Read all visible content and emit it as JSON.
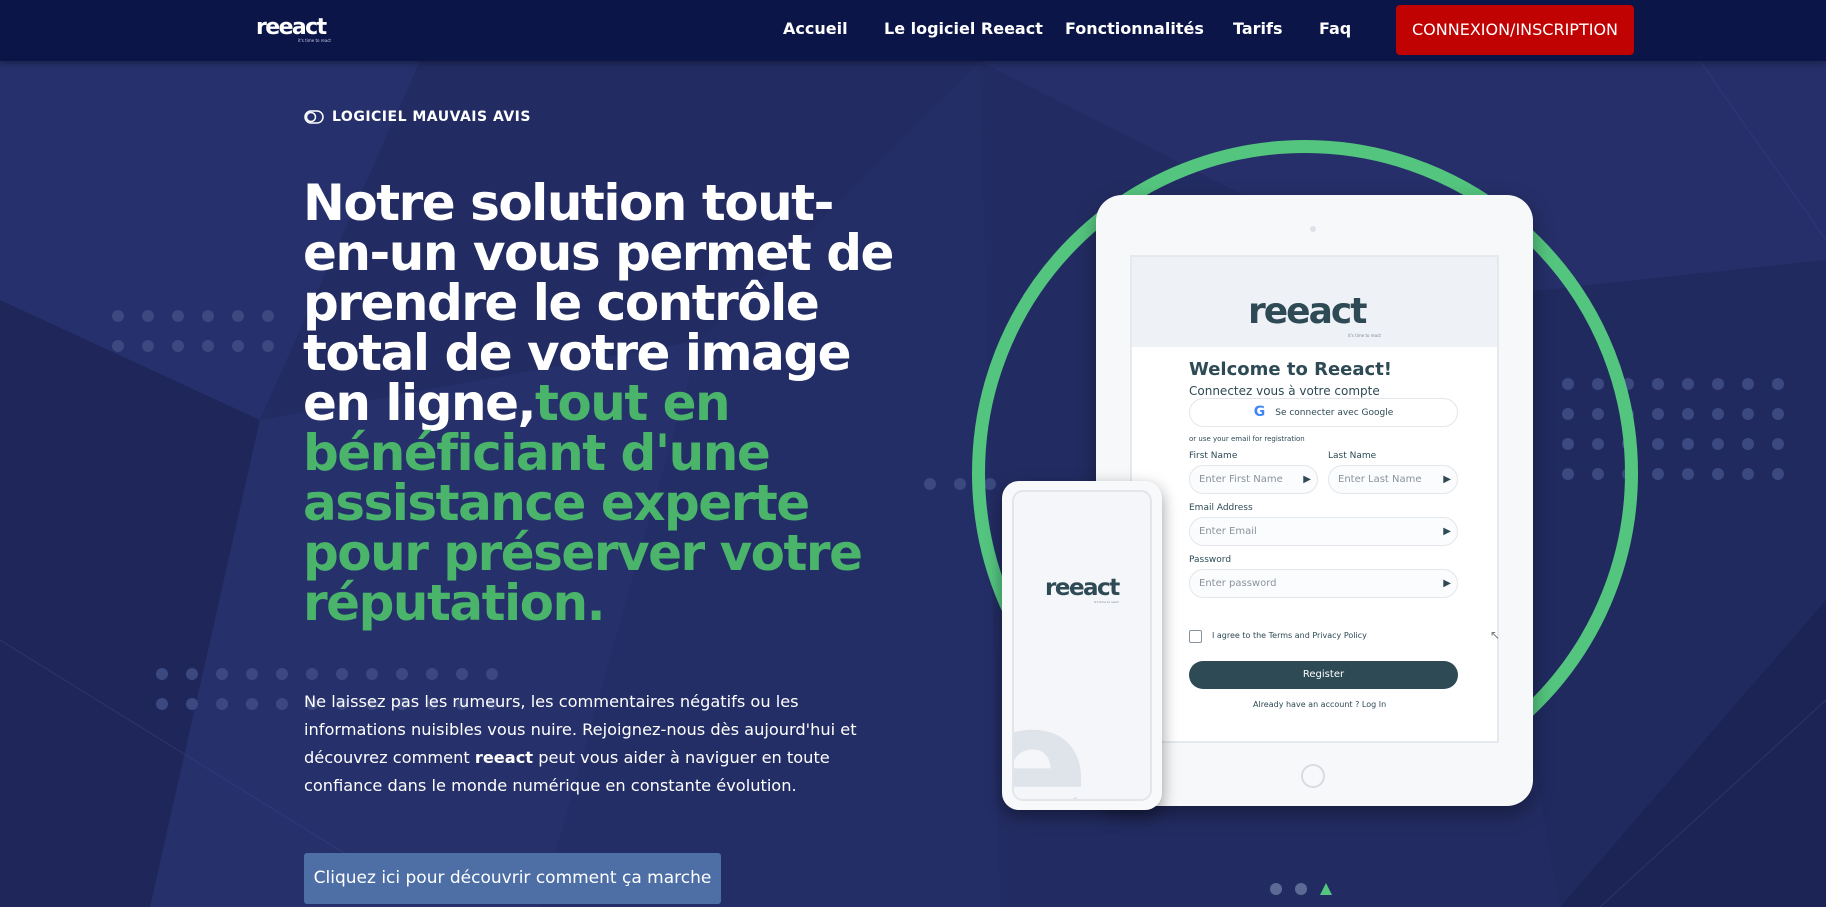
{
  "nav": {
    "logo": "reeact",
    "logo_tagline": "it's time to react",
    "links": [
      "Accueil",
      "Le logiciel Reeact",
      "Fonctionnalités",
      "Tarifs",
      "Faq"
    ],
    "cta_label": "CONNEXION/INSCRIPTION"
  },
  "hero": {
    "eyebrow": "LOGICIEL MAUVAIS AVIS",
    "headline_white": "Notre solution tout-en-un vous permet de prendre le contrôle total de votre image en ligne,",
    "headline_green": "tout en bénéficiant d'une assistance experte pour préserver votre réputation.",
    "paragraph_before": "Ne laissez pas les rumeurs, les commentaires négatifs ou les informations nuisibles vous nuire. Rejoignez-nous dès aujourd'hui et découvrez comment ",
    "paragraph_bold": "reeact",
    "paragraph_after": " peut vous aider à naviguer en toute confiance dans le monde numérique en constante évolution.",
    "button_label": "Cliquez ici pour découvrir comment ça marche"
  },
  "tablet_screen": {
    "logo": "reeact",
    "logo_tagline": "it's time to react",
    "welcome": "Welcome to Reeact!",
    "subtitle": "Connectez vous à votre compte",
    "google_label": "Se connecter avec Google",
    "google_letter": "G",
    "or_text": "or use your email for registration",
    "first_name_label": "First Name",
    "first_name_placeholder": "Enter First Name",
    "last_name_label": "Last Name",
    "last_name_placeholder": "Enter Last Name",
    "email_label": "Email Address",
    "email_placeholder": "Enter Email",
    "password_label": "Password",
    "password_placeholder": "Enter password",
    "agree_text": "I agree to the Terms and Privacy Policy",
    "register_label": "Register",
    "already_text": "Already have an account ?",
    "login_link": "Log In"
  },
  "phone_screen": {
    "logo": "reeact",
    "logo_tagline": "it's time to react",
    "watermark": "e"
  },
  "carousel": {
    "count": 3,
    "active_index": 2
  },
  "colors": {
    "nav_bg": "#0c1548",
    "page_bg": "#232c62",
    "green_accent": "#4ab46b",
    "cta_red": "#c00202",
    "button_blue": "#4d6fa6",
    "ring_green": "#54c57f"
  }
}
